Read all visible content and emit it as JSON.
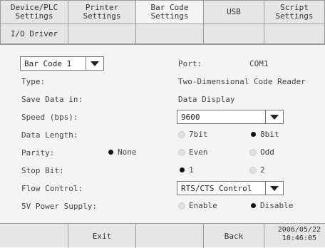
{
  "tabs": [
    {
      "label": "Device/PLC\nSettings",
      "active": false
    },
    {
      "label": "Printer\nSettings",
      "active": false
    },
    {
      "label": "Bar Code\nSettings",
      "active": true
    },
    {
      "label": "USB",
      "active": false
    },
    {
      "label": "Script\nSettings",
      "active": false
    }
  ],
  "second_row_tab": "I/O Driver",
  "selector": {
    "value": "Bar Code 1"
  },
  "port": {
    "label": "Port:",
    "value": "COM1"
  },
  "fields": {
    "type": {
      "label": "Type:",
      "value": "Two-Dimensional Code Reader"
    },
    "save_data": {
      "label": "Save Data in:",
      "value": "Data Display"
    },
    "speed": {
      "label": "Speed (bps):",
      "value": "9600"
    },
    "data_length": {
      "label": "Data Length:",
      "options": [
        "7bit",
        "8bit"
      ],
      "selected": "8bit"
    },
    "parity": {
      "label": "Parity:",
      "options": [
        "None",
        "Even",
        "Odd"
      ],
      "selected": "None"
    },
    "stop_bit": {
      "label": "Stop Bit:",
      "options": [
        "1",
        "2"
      ],
      "selected": "1"
    },
    "flow_control": {
      "label": "Flow Control:",
      "value": "RTS/CTS Control"
    },
    "power": {
      "label": "5V Power Supply:",
      "options": [
        "Enable",
        "Disable"
      ],
      "selected": "Disable"
    }
  },
  "footer": {
    "exit_label": "Exit",
    "back_label": "Back",
    "date": "2006/05/22",
    "time": "10:46:05"
  }
}
